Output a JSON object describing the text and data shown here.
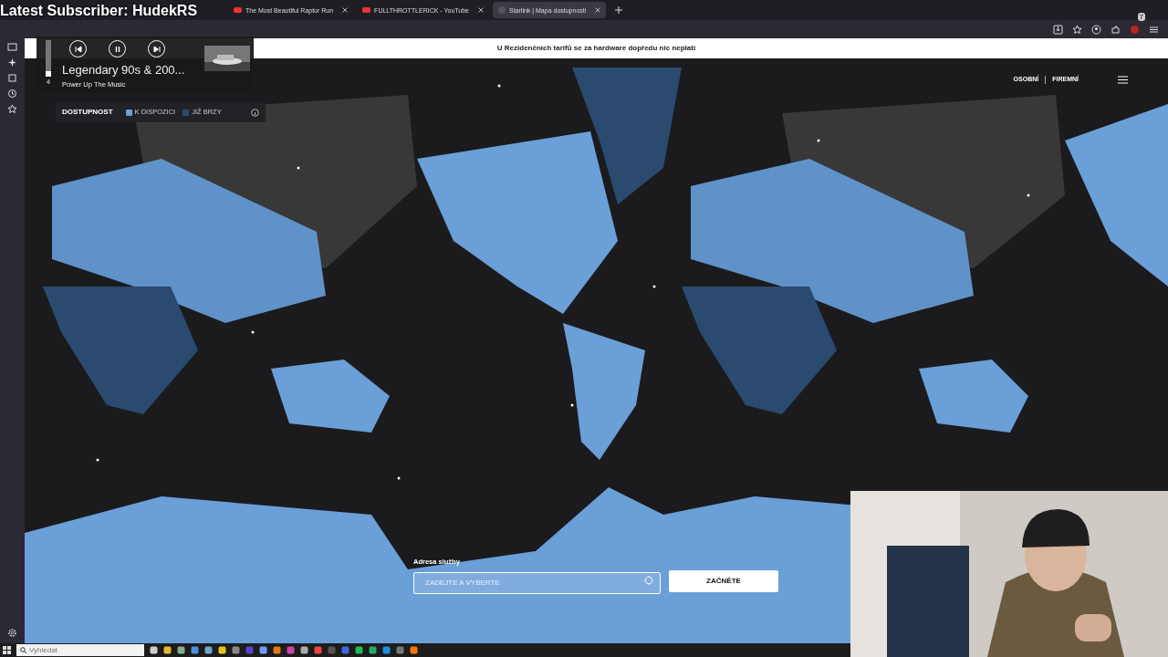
{
  "stream_overlay": {
    "subscriber": "Latest Subscriber: HudekRS"
  },
  "tabs": [
    {
      "label": "The Most Beautiful Raptor Run",
      "selected": false
    },
    {
      "label": "FULLTHROTTLERICK - YouTube",
      "selected": false
    },
    {
      "label": "Starlink | Mapa dostupnosti",
      "selected": true
    }
  ],
  "toolbar": {
    "extension_badge": "7"
  },
  "media_player": {
    "volume": "4",
    "level": 0.15,
    "playing": true,
    "title": "Legendary 90s & 200...",
    "artist": "Power Up The Music"
  },
  "banner": "U Rezidenčních tarifů se za hardware dopředu nic neplatí",
  "legend": {
    "title": "DOSTUPNOST",
    "items": [
      {
        "label": "K DISPOZICI",
        "color": "#6a9fd8"
      },
      {
        "label": "JIŽ BRZY",
        "color": "#2a4a70"
      }
    ]
  },
  "nav": [
    "OSOBNÍ",
    "FIREMNÍ"
  ],
  "address": {
    "label": "Adresa služby",
    "placeholder": "ZADEJTE A VYBERTE",
    "button": "ZAČNĚTE"
  },
  "taskbar": {
    "search_placeholder": "Vyhledat"
  }
}
